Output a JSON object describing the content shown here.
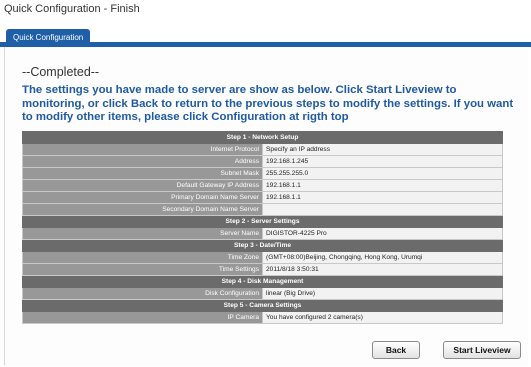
{
  "window": {
    "title": "Quick Configuration - Finish"
  },
  "tabs": [
    {
      "label": "Quick Configuration"
    }
  ],
  "content": {
    "completed": "--Completed--",
    "message": "The settings you have made to server are show as below. Click Start Liveview to monitoring, or click Back to return to the previous steps to modify the settings. If you want to modify other items, please click Configuration at rigth top"
  },
  "steps": {
    "network": {
      "title": "Step 1 - Network Setup",
      "rows": [
        {
          "label": "Internet Protocol",
          "value": "Specify an IP address"
        },
        {
          "label": "Address",
          "value": "192.168.1.245"
        },
        {
          "label": "Subnet Mask",
          "value": "255.255.255.0"
        },
        {
          "label": "Default Gateway IP Address",
          "value": "192.168.1.1"
        },
        {
          "label": "Primary Domain Name Server",
          "value": "192.168.1.1"
        },
        {
          "label": "Secondary Domain Name Server",
          "value": ""
        }
      ]
    },
    "server": {
      "title": "Step 2 - Server Settings",
      "rows": [
        {
          "label": "Server Name",
          "value": "DIGISTOR-4225 Pro"
        }
      ]
    },
    "datetime": {
      "title": "Step 3 - Date/Time",
      "rows": [
        {
          "label": "Time Zone",
          "value": "(GMT+08:00)Beijing, Chongqing, Hong Kong, Urumqi"
        },
        {
          "label": "Time Settings",
          "value": "2011/8/18 3:50:31"
        }
      ]
    },
    "disk": {
      "title": "Step 4 - Disk Management",
      "rows": [
        {
          "label": "Disk Configuration",
          "value": "linear (Big Drive)"
        }
      ]
    },
    "camera": {
      "title": "Step 5 - Camera Settings",
      "rows": [
        {
          "label": "IP Camera",
          "value": "You have configured 2 camera(s)"
        }
      ]
    }
  },
  "buttons": {
    "back": "Back",
    "start": "Start Liveview"
  }
}
